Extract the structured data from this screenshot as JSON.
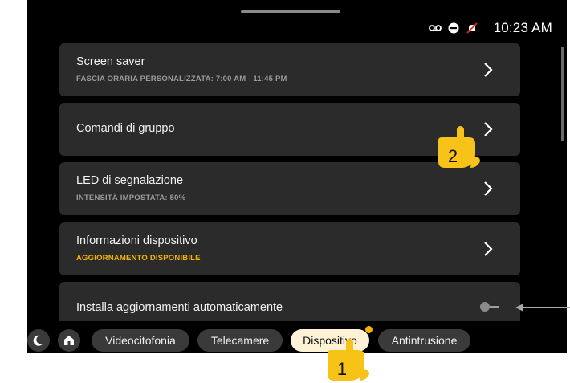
{
  "status_bar": {
    "icons": [
      "voicemail-icon",
      "do-not-disturb-icon",
      "bell-muted-icon"
    ],
    "time": "10:23 AM"
  },
  "settings": [
    {
      "title": "Screen saver",
      "subtitle": "FASCIA ORARIA PERSONALIZZATA: 7:00 AM - 11:45 PM",
      "control": "chevron"
    },
    {
      "title": "Comandi di gruppo",
      "subtitle": "",
      "control": "chevron"
    },
    {
      "title": "LED di segnalazione",
      "subtitle": "INTENSITÀ IMPOSTATA: 50%",
      "control": "chevron"
    },
    {
      "title": "Informazioni dispositivo",
      "subtitle": "AGGIORNAMENTO DISPONIBILE",
      "control": "chevron"
    },
    {
      "title": "Installa aggiornamenti automaticamente",
      "subtitle": "",
      "control": "toggle",
      "toggle_on": false
    }
  ],
  "bottom_nav": {
    "icons": [
      "moon-icon",
      "home-icon"
    ],
    "tabs": [
      "Videocitofonia",
      "Telecamere",
      "Dispositivo",
      "Antintrusione"
    ],
    "active_tab": "Dispositivo",
    "badge_on": "Dispositivo"
  },
  "annotations": {
    "step_1": "1",
    "step_2": "2"
  },
  "colors": {
    "screen_bg": "#000000",
    "card_bg": "#2b2b2b",
    "accent": "#f5b400",
    "active_tab_bg": "#fdf1d6",
    "hand_annotation": "#f7c318"
  }
}
